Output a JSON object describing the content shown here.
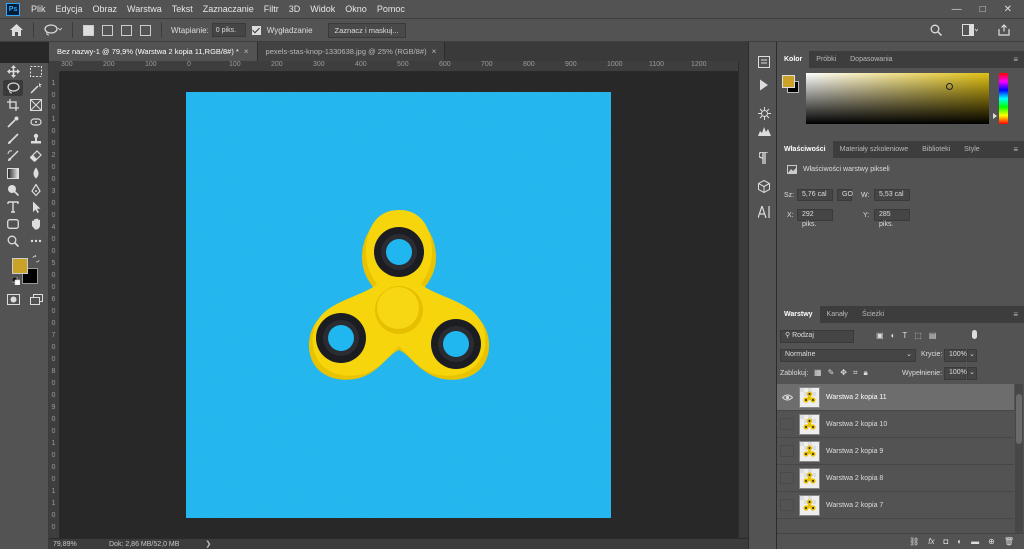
{
  "app": {
    "logo": "Ps"
  },
  "menu": [
    "Plik",
    "Edycja",
    "Obraz",
    "Warstwa",
    "Tekst",
    "Zaznaczanie",
    "Filtr",
    "3D",
    "Widok",
    "Okno",
    "Pomoc"
  ],
  "window_controls": {
    "minimize": "—",
    "maximize": "□",
    "close": "✕"
  },
  "options": {
    "feather_label": "Wtapianie:",
    "feather_value": "0 piks.",
    "antialias_label": "Wygładzanie",
    "select_mask_button": "Zaznacz i maskuj..."
  },
  "tabs": [
    {
      "label": "Bez nazwy-1 @ 79,9% (Warstwa 2 kopia 11,RGB/8#) *",
      "active": true,
      "close": "×"
    },
    {
      "label": "pexels-stas-knop-1330638.jpg @ 25% (RGB/8#)",
      "active": false,
      "close": "×"
    }
  ],
  "ruler_top": [
    "300",
    "200",
    "100",
    "0",
    "100",
    "200",
    "300",
    "400",
    "500",
    "600",
    "700",
    "800",
    "900",
    "1000",
    "1100",
    "1200"
  ],
  "ruler_left": [
    "1",
    "0",
    "0",
    "1",
    "0",
    "0",
    "2",
    "0",
    "0",
    "3",
    "0",
    "0",
    "4",
    "0",
    "0",
    "5",
    "0",
    "0",
    "6",
    "0",
    "0",
    "7",
    "0",
    "0",
    "8",
    "0",
    "0",
    "9",
    "0",
    "0",
    "1",
    "0",
    "0",
    "0",
    "1",
    "1",
    "0",
    "0"
  ],
  "status": {
    "zoom": "79,89%",
    "doc": "Dok: 2,86 MB/52,0 MB",
    "arrow": "❯"
  },
  "colors": {
    "foreground": "#c9a227",
    "background": "#000000",
    "canvas_bg": "#20b6f0",
    "spinner": "#f5d40f"
  },
  "color_panel": {
    "tabs": [
      "Kolor",
      "Próbki",
      "Dopasowania"
    ],
    "menu": "≡"
  },
  "properties_panel": {
    "tabs": [
      "Właściwości",
      "Materiały szkoleniowe",
      "Biblioteki",
      "Style"
    ],
    "menu": "≡",
    "header": "Właściwości warstwy pikseli",
    "w_label": "Sz:",
    "w_value": "5,76 cal",
    "h_label": "W:",
    "h_value": "5,53 cal",
    "x_label": "X:",
    "x_value": "292 piks.",
    "y_label": "Y:",
    "y_value": "285 piks.",
    "link_icon": "GO"
  },
  "layers_panel": {
    "tabs": [
      "Warstwy",
      "Kanały",
      "Ścieżki"
    ],
    "menu": "≡",
    "filter_label": "Rodzaj",
    "blend_mode": "Normalne",
    "opacity_label": "Krycie:",
    "opacity_value": "100%",
    "lock_label": "Zablokuj:",
    "fill_label": "Wypełnienie:",
    "fill_value": "100%",
    "layers": [
      {
        "name": "Warstwa 2 kopia 11",
        "visible": true,
        "selected": true
      },
      {
        "name": "Warstwa 2 kopia 10",
        "visible": false,
        "selected": false
      },
      {
        "name": "Warstwa 2 kopia 9",
        "visible": false,
        "selected": false
      },
      {
        "name": "Warstwa 2 kopia 8",
        "visible": false,
        "selected": false
      },
      {
        "name": "Warstwa 2 kopia 7",
        "visible": false,
        "selected": false
      }
    ],
    "bottom_icons": [
      "⛓",
      "fx",
      "◘",
      "◐",
      "▬",
      "⊕",
      "🗑"
    ]
  }
}
